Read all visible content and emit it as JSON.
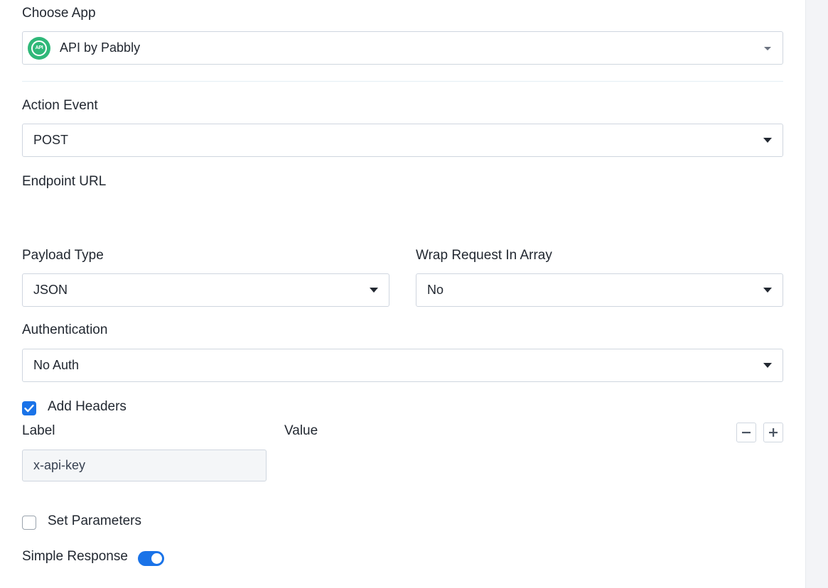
{
  "choose_app": {
    "label": "Choose App",
    "value": "API by Pabbly",
    "icon_text": "API"
  },
  "action_event": {
    "label": "Action Event",
    "value": "POST"
  },
  "endpoint": {
    "label": "Endpoint URL"
  },
  "payload_type": {
    "label": "Payload Type",
    "value": "JSON"
  },
  "wrap_request": {
    "label": "Wrap Request In Array",
    "value": "No"
  },
  "authentication": {
    "label": "Authentication",
    "value": "No Auth"
  },
  "add_headers": {
    "label": "Add Headers",
    "checked": true
  },
  "headers": {
    "label_header": "Label",
    "value_header": "Value",
    "rows": [
      {
        "label": "x-api-key",
        "value": ""
      }
    ]
  },
  "set_parameters": {
    "label": "Set Parameters",
    "checked": false
  },
  "simple_response": {
    "label": "Simple Response",
    "enabled": true
  },
  "colors": {
    "accent": "#1a73e8",
    "app_icon": "#2fb879",
    "border": "#cfd6df"
  }
}
